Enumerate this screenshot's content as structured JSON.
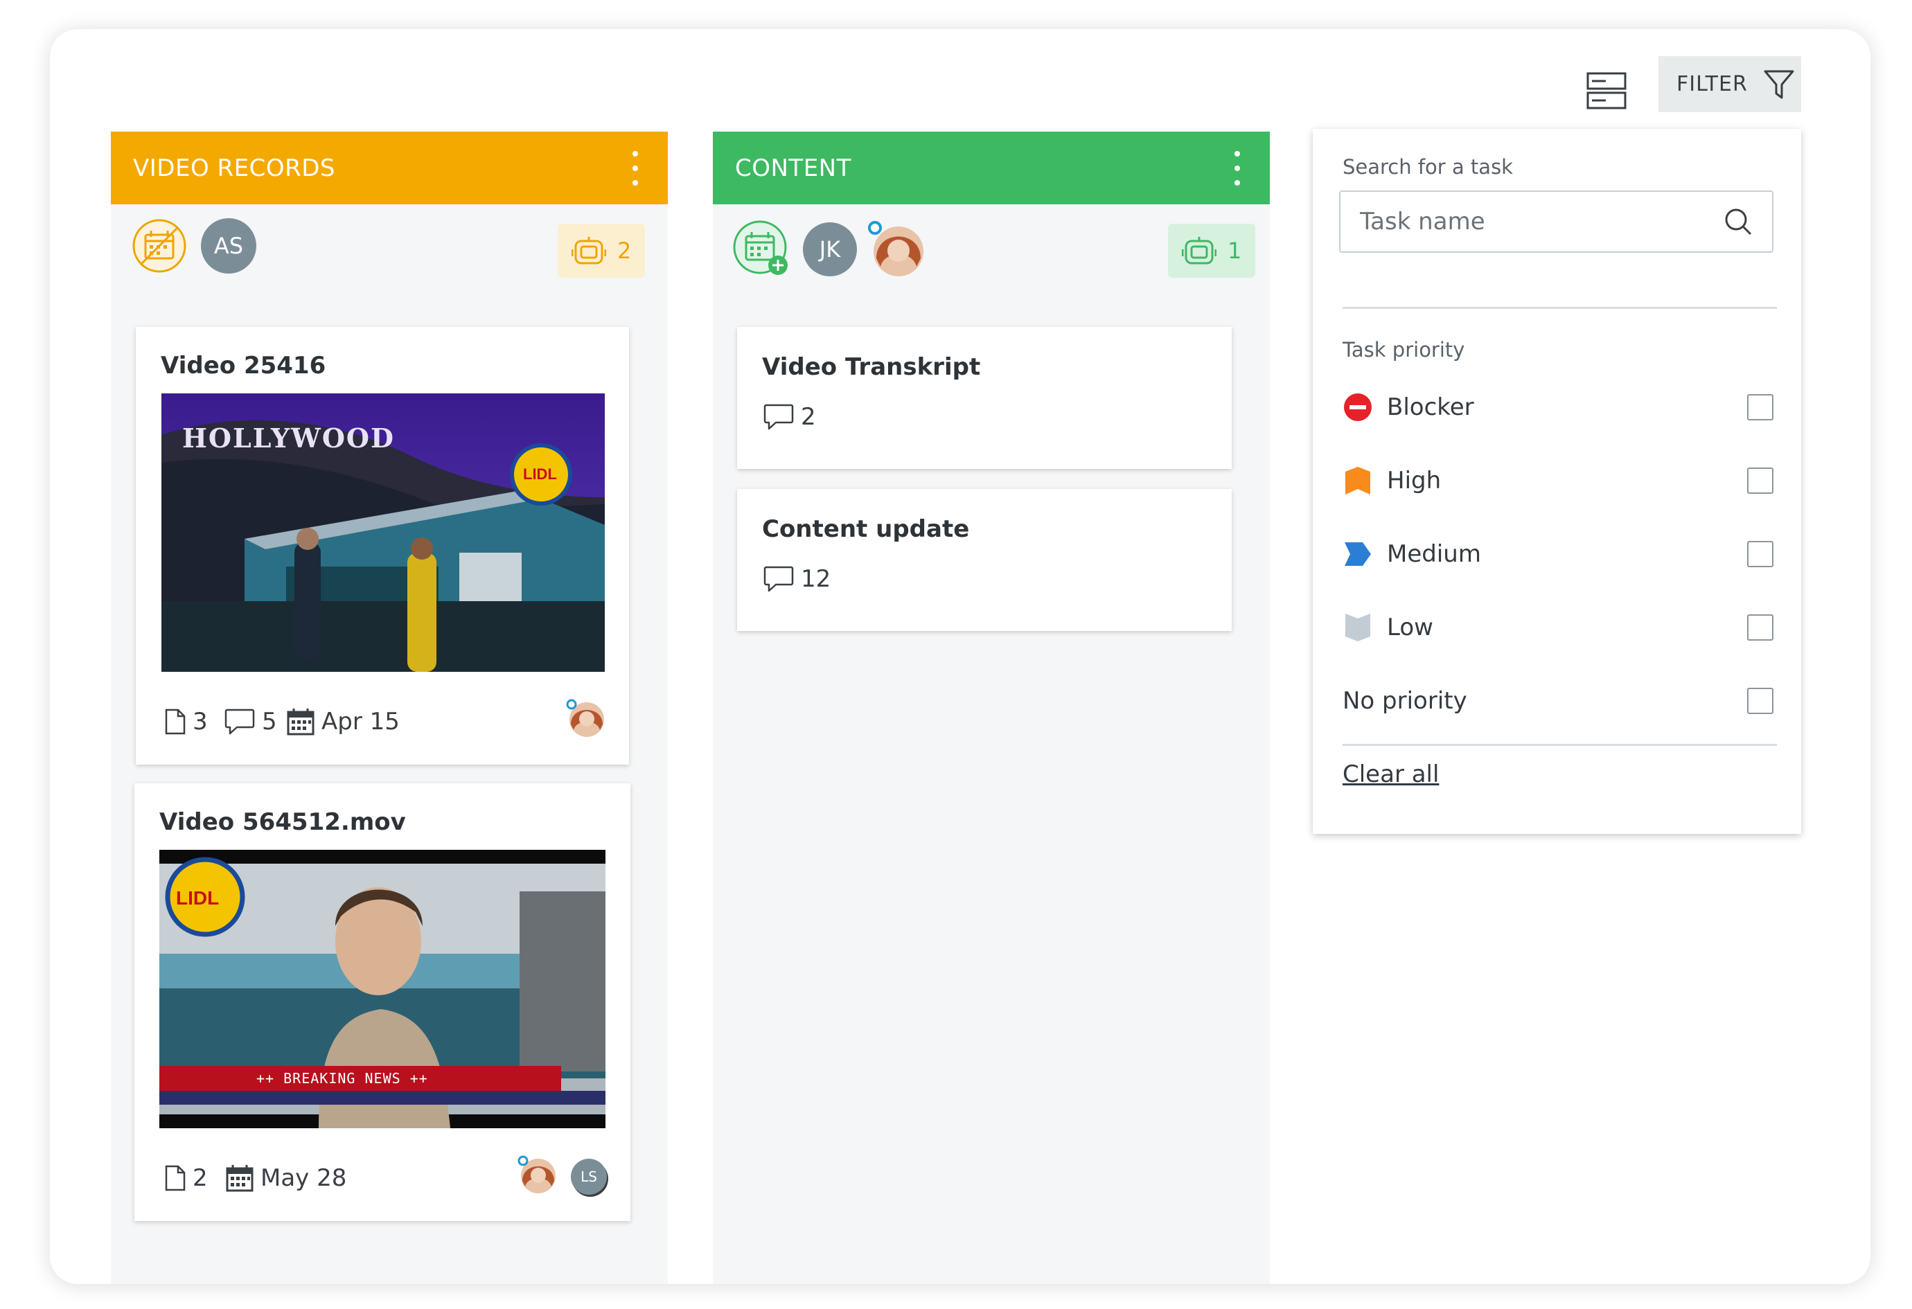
{
  "toolbar": {
    "view_toggle_icon": "list-layout-icon",
    "filter_label": "FILTER",
    "filter_icon": "funnel-icon"
  },
  "columns": [
    {
      "title": "VIDEO RECORDS",
      "color": "#f4a901",
      "members": [
        "AS"
      ],
      "bot_count": "2",
      "cards": [
        {
          "title": "Video 25416",
          "thumbnail": "hollywood-lidl-scene",
          "thumb_caption": "HOLLYWOOD",
          "logo_text": "LIDL",
          "files": "3",
          "comments": "5",
          "due": "Apr 15"
        },
        {
          "title": "Video 564512.mov",
          "thumbnail": "breaking-news-scene",
          "logo_text": "LIDL",
          "ticker_text": "++ BREAKING NEWS ++",
          "files": "2",
          "due": "May 28",
          "assignee_initials": "LS"
        }
      ]
    },
    {
      "title": "CONTENT",
      "color": "#3db962",
      "members": [
        "JK"
      ],
      "bot_count": "1",
      "cards": [
        {
          "title": "Video Transkript",
          "comments": "2"
        },
        {
          "title": "Content update",
          "comments": "12"
        }
      ]
    }
  ],
  "filter_panel": {
    "search_label": "Search for a task",
    "search_placeholder": "Task name",
    "priority_label": "Task priority",
    "priorities": [
      {
        "label": "Blocker",
        "color": "#e8202a",
        "icon": "blocker-icon"
      },
      {
        "label": "High",
        "color": "#f98b1c",
        "icon": "flag-high-icon"
      },
      {
        "label": "Medium",
        "color": "#2a7fd4",
        "icon": "arrow-medium-icon"
      },
      {
        "label": "Low",
        "color": "#c3ccd4",
        "icon": "flag-low-icon"
      },
      {
        "label": "No priority"
      }
    ],
    "clear_all": "Clear all"
  }
}
